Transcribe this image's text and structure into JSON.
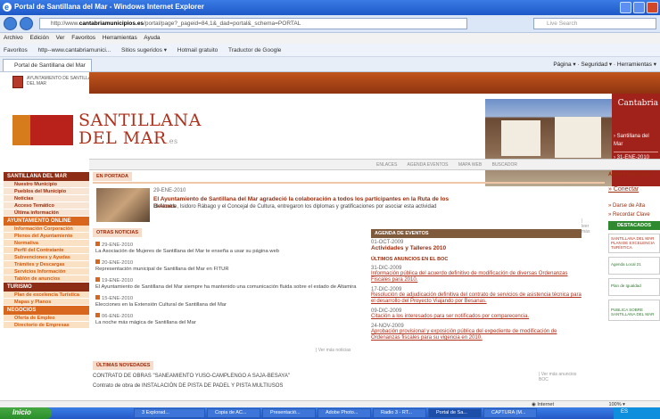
{
  "window": {
    "title": "Portal de Santillana del Mar - Windows Internet Explorer"
  },
  "address": {
    "url_prefix": "http://www.",
    "url_domain": "cantabriamunicipios.es",
    "url_rest": "/portal/page?_pageid=84,1&_dad=portal&_schema=PORTAL",
    "search_placeholder": "Live Search"
  },
  "menu": [
    "Archivo",
    "Edición",
    "Ver",
    "Favoritos",
    "Herramientas",
    "Ayuda"
  ],
  "favorites": [
    "Favoritos",
    "http--www.cantabriamunici...",
    "Sitios sugeridos ▾",
    "Hotmail gratuito",
    "Traductor de Google"
  ],
  "tab": {
    "label": "Portal de Santillana del Mar"
  },
  "toolbar": {
    "page": "Página ▾",
    "security": "Seguridad ▾",
    "tools": "Herramientas ▾"
  },
  "site": {
    "munic": "AYUNTAMIENTO DE SANTILLANA DEL MAR",
    "logo_line1": "SANTILLANA",
    "logo_line2": "DEL MAR",
    "logo_es": ".es",
    "cantabria": "Cantabria",
    "cant_link": "› Santillana del Mar",
    "cant_date": "› 31-ENE-2010",
    "greybar": [
      "ENLACES",
      "AGENDA EVENTOS",
      "MAPA WEB",
      "BUSCADOR"
    ],
    "left_nav": {
      "sec1": "SANTILLANA DEL MAR",
      "items1": [
        "Nuestro Municipio",
        "Pueblos del Municipio",
        "Noticias",
        "Acceso Temático",
        "Última información"
      ],
      "sec2": "AYUNTAMIENTO ONLINE",
      "items2": [
        "Información Corporación",
        "Plenos del Ayuntamiento",
        "Normativa",
        "Perfil del Contratante",
        "Subvenciones y Ayudas",
        "Trámites y Descargas",
        "Servicios Información",
        "Tablón de anuncios"
      ],
      "sec3": "TURISMO",
      "items3": [
        "Plan de excelencia Turística",
        "Mapas y Planos"
      ],
      "sec4": "NEGOCIOS",
      "items4": [
        "Oferta de Empleo",
        "Directorio de Empresas"
      ]
    },
    "portada": {
      "tab": "EN PORTADA",
      "date": "29-ENE-2010",
      "title": "El Ayuntamiento de Santillana del Mar agradeció la colaboración a todos los participantes en la Ruta de los Belenes",
      "text": "El Alcalde, Isidoro Rábago y el Concejal de Cultura, entregaron los diplomas y gratificaciones por asociar esta actividad",
      "more": "| leer más"
    },
    "otras": {
      "title": "OTRAS NOTICIAS",
      "items": [
        {
          "date": "29-ENE-2010",
          "text": "La Asociación de Mujeres de Santillana del Mar te enseña a usar su página web"
        },
        {
          "date": "20-ENE-2010",
          "text": "Representación municipal de Santillana del Mar en FITUR"
        },
        {
          "date": "19-ENE-2010",
          "text": "El Ayuntamiento de Santillana del Mar siempre ha mantenido una comunicación fluida sobre el estado de Altamira"
        },
        {
          "date": "15-ENE-2010",
          "text": "Elecciones en la Extensión Cultural de Santillana del Mar"
        },
        {
          "date": "06-ENE-2010",
          "text": "La noche más mágica de Santillana del Mar"
        }
      ],
      "more": "| Ver más noticias"
    },
    "novedades": {
      "title": "ÚLTIMAS NOVEDADES",
      "items": [
        "CONTRATO DE OBRAS \"SANEAMIENTO YUSO-CAMPLENGO A SAJA-BESAYA\"",
        "Contrato de obra de INSTALACIÓN DE PISTA DE PADEL Y PISTA MULTIUSOS"
      ]
    },
    "agenda": {
      "title": "AGENDA DE EVENTOS",
      "date": "01-OCT-2009",
      "event": "Actividades y Talleres 2010",
      "boc_title": "ÚLTIMOS ANUNCIOS EN EL BOC",
      "boc": [
        {
          "date": "31-DIC-2009",
          "text": "Información pública del acuerdo definitivo de modificación de diversas Ordenanzas Fiscales para 2010."
        },
        {
          "date": "17-DIC-2009",
          "text": "Resolución de adjudicación definitiva del contrato de servicios de asistencia técnica para el desarrollo del Proyecto Viajando por Besanas."
        },
        {
          "date": "09-DIC-2009",
          "text": "Citación a los interesados para ser notificados por comparecencia."
        },
        {
          "date": "24-NOV-2009",
          "text": "Aprobación provisional y exposición pública del expediente de modificación de Ordenanzas fiscales para su vigencia en 2010."
        }
      ],
      "more": "| Ver más anuncios BOC"
    },
    "right": {
      "area": "ÁREA PERSONAL",
      "connect": "» Conectar",
      "register": "» Darse de Alta",
      "remember": "» Recordar Clave",
      "dest": "DESTACADOS",
      "banner1": "SANTILLANA DEL MAR",
      "banner1b": "PLAN DE EXCELENCIA TURÍSTICA",
      "banner2": "Agenda Local 21",
      "banner3": "Plan de Igualdad",
      "banner4": "PUBLICA SOBRE SANTILLANA DEL MAR"
    }
  },
  "statusbar": {
    "zone": "Internet",
    "zoom": "100% ▾"
  },
  "taskbar": {
    "start": "Inicio",
    "items": [
      "3 Explorad...",
      "Copia de AC...",
      "Presentació...",
      "Adobe Photo...",
      "Radio 3 - RT...",
      "Portal de Sa...",
      "CAPTURA (M..."
    ],
    "clock": "ES"
  }
}
